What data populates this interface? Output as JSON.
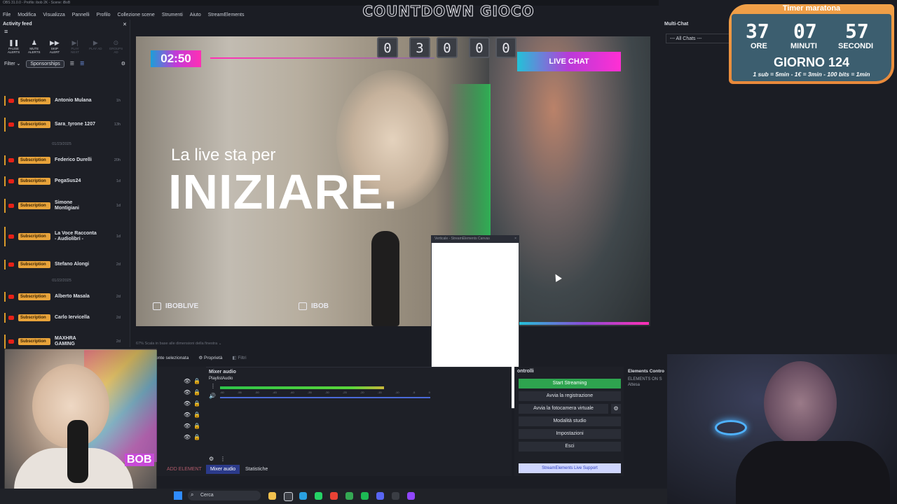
{
  "window": {
    "title": "OBS 31.0.0 - Profilo: ibob 2K - Scene: iBoB"
  },
  "menu": [
    "File",
    "Modifica",
    "Visualizza",
    "Pannelli",
    "Profilo",
    "Collezione scene",
    "Strumenti",
    "Aiuto",
    "StreamElements"
  ],
  "overlay_title": "COUNTDOWN GIOCO",
  "activity_feed": {
    "title": "Activity feed",
    "controls": [
      {
        "label": "PAUSE ALERTS",
        "icon": "pause-icon",
        "enabled": true
      },
      {
        "label": "MUTE ALERTS",
        "icon": "bell-icon",
        "enabled": true
      },
      {
        "label": "SKIP ALERT",
        "icon": "skip-icon",
        "enabled": true
      },
      {
        "label": "PLAY NEXT",
        "icon": "next-icon",
        "enabled": false
      },
      {
        "label": "PLAY AD",
        "icon": "play-icon",
        "enabled": false
      },
      {
        "label": "GROUPS AD",
        "icon": "group-icon",
        "enabled": false
      }
    ],
    "filter_label": "Filter",
    "filter_value": "Sponsorships",
    "badge_label": "Subscription",
    "items": [
      {
        "name": "Antonio Mulana",
        "time": "1h"
      },
      {
        "name": "Sara_tyrone 1207",
        "time": "13h"
      },
      {
        "name": "Federico Durelli",
        "time": "20h"
      },
      {
        "name": "PegaSus24",
        "time": "1d"
      },
      {
        "name": "Simone Montigiani",
        "time": "1d"
      },
      {
        "name": "La Voce Racconta - Audiolibri -",
        "time": "1d"
      },
      {
        "name": "Stefano Alongi",
        "time": "2d"
      },
      {
        "name": "Alberto Masala",
        "time": "2d"
      },
      {
        "name": "Carlo Iervicella",
        "time": "2d"
      },
      {
        "name": "MAXHRA GAMING",
        "time": "2d"
      }
    ],
    "dates": [
      "01/23/2025",
      "01/22/2025"
    ]
  },
  "preview": {
    "countdown_digits": [
      "0",
      "3",
      "0",
      "0",
      "0"
    ],
    "timer": "02:50",
    "live_chat": "LIVE CHAT",
    "subtitle": "La live sta per",
    "headline": "INIZIARE.",
    "socials": [
      {
        "label": "IBOBLIVE",
        "icon": "instagram-icon"
      },
      {
        "label": "IBOB",
        "icon": "youtube-icon"
      }
    ]
  },
  "canvas_popup": {
    "title": "Verticale - StreamElements Canvas"
  },
  "status": {
    "scale_text": "Scala in base alle dimensioni della finestra",
    "scale_pct": "67%"
  },
  "source_bar": {
    "no_source": "onte selezionata",
    "properties": "Proprietà",
    "filters": "Filtri"
  },
  "mixer": {
    "title": "Mixer audio",
    "source": "PlaylistAudio",
    "scale_ticks": [
      "-60",
      "-55",
      "-50",
      "-45",
      "-40",
      "-35",
      "-30",
      "-25",
      "-20",
      "-15",
      "-10",
      "-5",
      "0"
    ],
    "level": 0.78,
    "tabs": [
      "Mixer audio",
      "Statistiche"
    ],
    "add_element": "ADD ELEMENT"
  },
  "controls": {
    "title": "ontrolli",
    "buttons": [
      "Start Streaming",
      "Avvia la registrazione",
      "Avvia la fotocamera virtuale",
      "Modalità studio",
      "Impostazioni",
      "Esci"
    ],
    "support": "StreamElements Live Support"
  },
  "elements_panel": {
    "title": "Elements Contro",
    "line1": "ELEMENTS ON S",
    "line2": "Attesa"
  },
  "multichat": {
    "title": "Multi-Chat",
    "select": "--- All Chats ---"
  },
  "marathon": {
    "title": "Timer maratona",
    "hours": "37",
    "minutes": "07",
    "seconds": "57",
    "labels": [
      "ORE",
      "MINUTI",
      "SECONDI"
    ],
    "day": "GIORNO 124",
    "rules": "1 sub = 5min - 1€ = 3min - 100 bits = 1min"
  },
  "cam_overlay_text": "BOB",
  "taskbar": {
    "search": "Cerca"
  },
  "colors": {
    "accent_green": "#2ea44f",
    "badge": "#e8a33a",
    "marathon_orange": "#e98a3b",
    "live_chat_pink": "#ff2fd4"
  }
}
